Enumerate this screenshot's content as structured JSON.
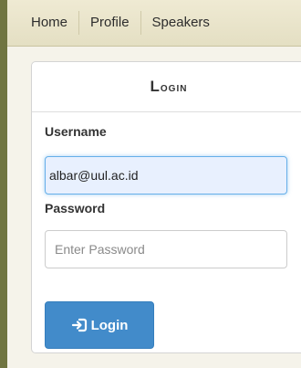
{
  "nav": {
    "items": [
      "Home",
      "Profile",
      "Speakers"
    ]
  },
  "login_panel": {
    "title_first": "L",
    "title_rest": "ogin",
    "username_label": "Username",
    "username_value": "albar@uul.ac.id",
    "password_label": "Password",
    "password_placeholder": "Enter Password",
    "button_label": "Login",
    "button_icon": "sign-in-icon"
  },
  "colors": {
    "frame": "#707541",
    "navbar": "#e8e3c8",
    "button": "#428bca",
    "focus_border": "#66afe9"
  }
}
